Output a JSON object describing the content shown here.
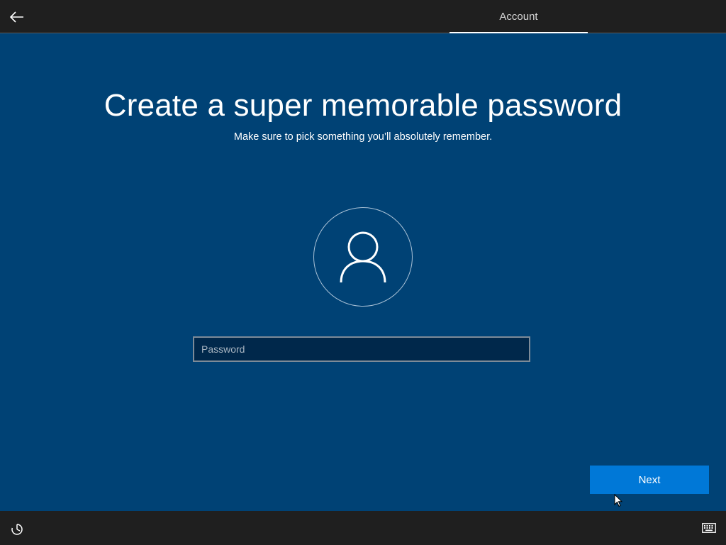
{
  "header": {
    "back_icon": "back-arrow-icon",
    "active_tab": "Account"
  },
  "main": {
    "title": "Create a super memorable password",
    "subtitle": "Make sure to pick something you’ll absolutely remember.",
    "avatar_icon": "user-icon",
    "password": {
      "placeholder": "Password",
      "value": ""
    },
    "next_label": "Next"
  },
  "footer": {
    "ease_of_access_icon": "ease-of-access-icon",
    "keyboard_icon": "keyboard-icon"
  },
  "colors": {
    "background": "#004275",
    "bar": "#1f1f1f",
    "accent": "#0078d7"
  }
}
